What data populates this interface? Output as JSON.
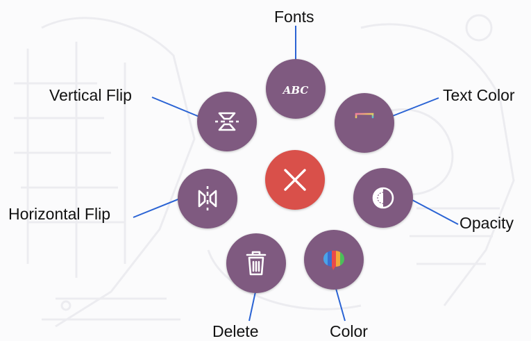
{
  "menu": {
    "fonts": {
      "label": "Fonts",
      "icon": "abc-icon",
      "icon_text": "ABC"
    },
    "text_color": {
      "label": "Text Color",
      "icon": "text-color-icon"
    },
    "opacity": {
      "label": "Opacity",
      "icon": "opacity-icon"
    },
    "color": {
      "label": "Color",
      "icon": "color-bubble-icon"
    },
    "delete": {
      "label": "Delete",
      "icon": "trash-icon"
    },
    "horizontal_flip": {
      "label": "Horizontal Flip",
      "icon": "horizontal-flip-icon"
    },
    "vertical_flip": {
      "label": "Vertical Flip",
      "icon": "vertical-flip-icon"
    },
    "close": {
      "icon": "close-icon"
    }
  },
  "colors": {
    "button_bg": "#7f5a80",
    "close_bg": "#d9504a",
    "callout_line": "#2a63d4",
    "icon_fg": "#ffffff"
  }
}
